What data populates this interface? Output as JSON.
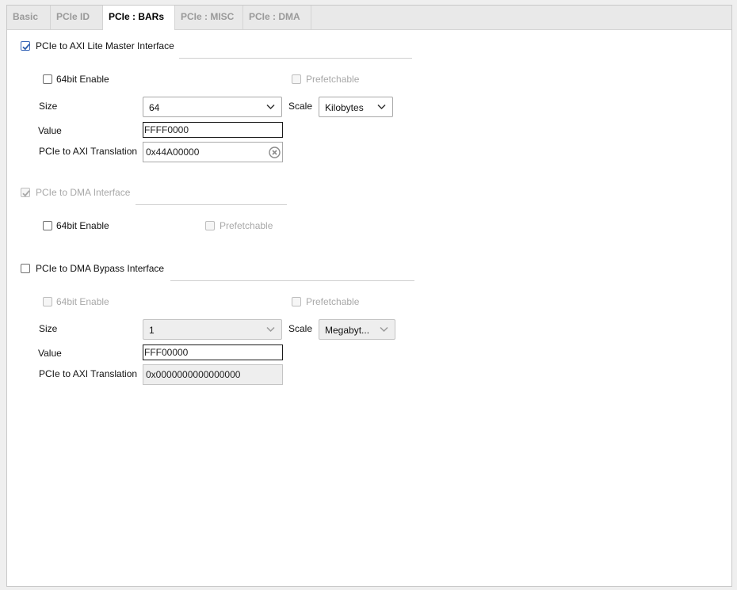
{
  "tabs": [
    {
      "label": "Basic",
      "active": false
    },
    {
      "label": "PCIe ID",
      "active": false
    },
    {
      "label": "PCIe : BARs",
      "active": true
    },
    {
      "label": "PCIe : MISC",
      "active": false
    },
    {
      "label": "PCIe : DMA",
      "active": false
    }
  ],
  "axi_lite": {
    "title": "PCIe to AXI Lite Master Interface",
    "checked": true,
    "bit64_label": "64bit Enable",
    "prefetch_label": "Prefetchable",
    "size_label": "Size",
    "size_value": "64",
    "scale_label": "Scale",
    "scale_value": "Kilobytes",
    "value_label": "Value",
    "value": "FFFF0000",
    "translation_label": "PCIe to AXI Translation",
    "translation_value": "0x44A00000"
  },
  "dma": {
    "title": "PCIe to DMA Interface",
    "checked": true,
    "disabled": true,
    "bit64_label": "64bit Enable",
    "prefetch_label": "Prefetchable"
  },
  "dma_bypass": {
    "title": "PCIe to DMA Bypass Interface",
    "checked": false,
    "bit64_label": "64bit Enable",
    "prefetch_label": "Prefetchable",
    "size_label": "Size",
    "size_value": "1",
    "scale_label": "Scale",
    "scale_value": "Megabyt...",
    "value_label": "Value",
    "value": "FFF00000",
    "translation_label": "PCIe to AXI Translation",
    "translation_value": "0x0000000000000000"
  },
  "colors": {
    "accent": "#3967b8",
    "disabled_text": "#a8a8a8",
    "tab_bg": "#e9e9e9"
  }
}
